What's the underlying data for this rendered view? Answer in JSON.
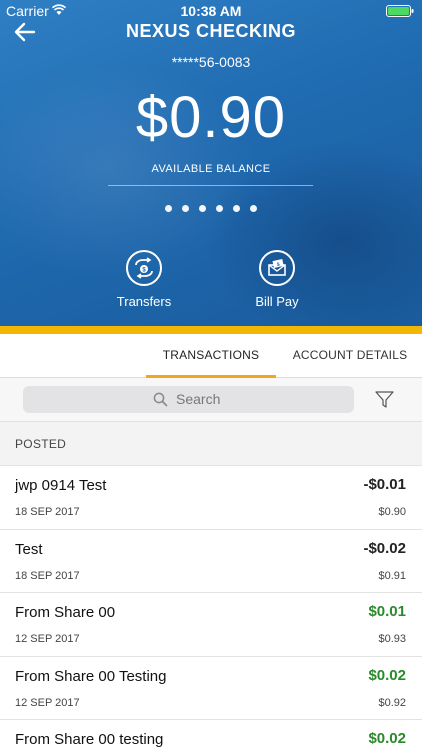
{
  "status_bar": {
    "carrier": "Carrier",
    "time": "10:38 AM"
  },
  "header": {
    "title": "NEXUS CHECKING",
    "account_number": "*****56-0083",
    "balance": "$0.90",
    "balance_label": "AVAILABLE BALANCE",
    "page_dots": 6
  },
  "actions": [
    {
      "label": "Transfers",
      "icon": "transfer-money-icon"
    },
    {
      "label": "Bill Pay",
      "icon": "bill-envelope-icon"
    }
  ],
  "tabs": [
    {
      "label": "TRANSACTIONS",
      "active": true
    },
    {
      "label": "ACCOUNT DETAILS",
      "active": false
    }
  ],
  "search": {
    "placeholder": "Search"
  },
  "section": {
    "label": "POSTED"
  },
  "transactions": [
    {
      "description": "jwp 0914 Test",
      "date": "18 SEP 2017",
      "amount": "-$0.01",
      "balance": "$0.90"
    },
    {
      "description": "Test",
      "date": "18 SEP 2017",
      "amount": "-$0.02",
      "balance": "$0.91"
    },
    {
      "description": "From Share 00",
      "date": "12 SEP 2017",
      "amount": "$0.01",
      "balance": "$0.93"
    },
    {
      "description": "From Share 00 Testing",
      "date": "12 SEP 2017",
      "amount": "$0.02",
      "balance": "$0.92"
    },
    {
      "description": "From Share 00 testing",
      "date": "",
      "amount": "$0.02",
      "balance": ""
    }
  ],
  "colors": {
    "hero_blue": "#1f6ab0",
    "accent_gold": "#f2b705",
    "positive_green": "#2a8a2a"
  }
}
